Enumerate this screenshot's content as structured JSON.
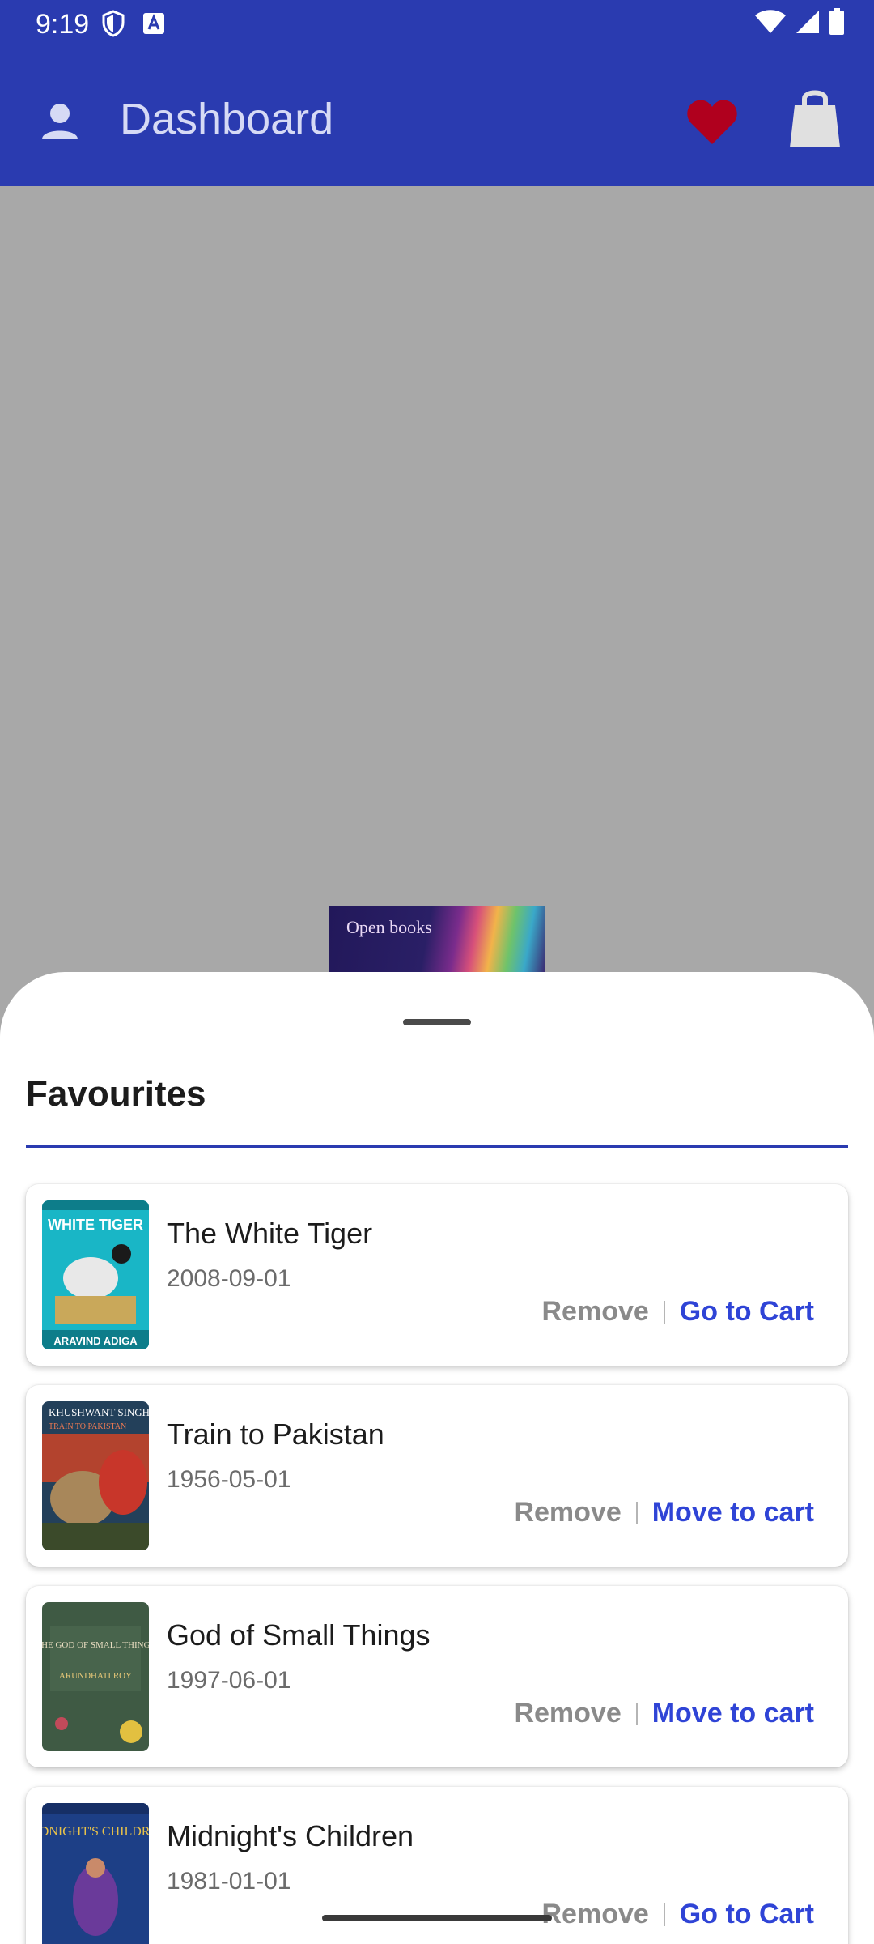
{
  "status_bar": {
    "time": "9:19"
  },
  "app_bar": {
    "title": "Dashboard",
    "heart_color": "#b0001e"
  },
  "background": {
    "book_peek_text": "Open books"
  },
  "favourites": {
    "title": "Favourites",
    "items": [
      {
        "title": "The White Tiger",
        "date": "2008-09-01",
        "remove_label": "Remove",
        "cart_label": "Go to Cart",
        "cover_text_top": "WHITE TIGER",
        "cover_text_bottom": "ARAVIND ADIGA"
      },
      {
        "title": "Train to Pakistan",
        "date": "1956-05-01",
        "remove_label": "Remove",
        "cart_label": "Move to cart",
        "cover_text_top": "KHUSHWANT SINGH",
        "cover_text_bottom": "TRAIN TO PAKISTAN"
      },
      {
        "title": "God of Small Things",
        "date": "1997-06-01",
        "remove_label": "Remove",
        "cart_label": "Move to cart",
        "cover_text_top": "THE GOD OF SMALL THINGS",
        "cover_text_bottom": "ARUNDHATI ROY"
      },
      {
        "title": "Midnight's Children",
        "date": "1981-01-01",
        "remove_label": "Remove",
        "cart_label": "Go to Cart",
        "cover_text_top": "MIDNIGHT'S CHILDREN",
        "cover_text_bottom": ""
      }
    ]
  }
}
